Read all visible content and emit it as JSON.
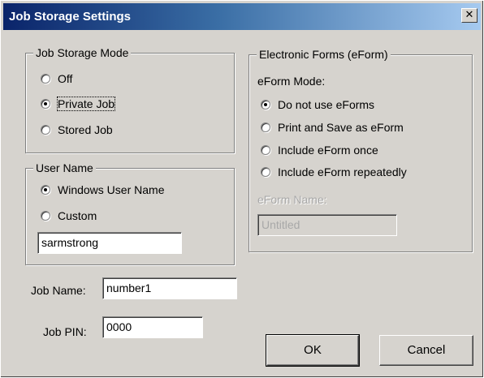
{
  "window": {
    "title": "Job Storage Settings",
    "close_glyph": "✕"
  },
  "job_storage_mode": {
    "legend": "Job Storage Mode",
    "options": [
      {
        "label": "Off",
        "checked": false
      },
      {
        "label": "Private Job",
        "checked": true
      },
      {
        "label": "Stored Job",
        "checked": false
      }
    ]
  },
  "user_name": {
    "legend": "User Name",
    "options": [
      {
        "label": "Windows User Name",
        "checked": true
      },
      {
        "label": "Custom",
        "checked": false
      }
    ],
    "custom_value": "sarmstrong"
  },
  "job_name": {
    "label": "Job Name:",
    "value": "number1"
  },
  "job_pin": {
    "label": "Job PIN:",
    "value": "0000"
  },
  "eform": {
    "legend": "Electronic Forms (eForm)",
    "mode_label": "eForm Mode:",
    "options": [
      {
        "label": "Do not use eForms",
        "checked": true
      },
      {
        "label": "Print and Save as eForm",
        "checked": false
      },
      {
        "label": "Include eForm once",
        "checked": false
      },
      {
        "label": "Include eForm repeatedly",
        "checked": false
      }
    ],
    "name_label": "eForm Name:",
    "name_value": "Untitled"
  },
  "buttons": {
    "ok": "OK",
    "cancel": "Cancel"
  }
}
